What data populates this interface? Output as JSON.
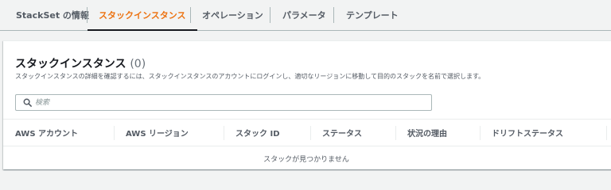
{
  "tabs": [
    {
      "label": "StackSet の情報",
      "active": false
    },
    {
      "label": "スタックインスタンス",
      "active": true
    },
    {
      "label": "オペレーション",
      "active": false
    },
    {
      "label": "パラメータ",
      "active": false
    },
    {
      "label": "テンプレート",
      "active": false
    }
  ],
  "panel": {
    "title": "スタックインスタンス",
    "count": "(0)",
    "description": "スタックインスタンスの詳細を確認するには、スタックインスタンスのアカウントにログインし、適切なリージョンに移動して目的のスタックを名前で選択します。"
  },
  "search": {
    "placeholder": "検索",
    "value": ""
  },
  "table": {
    "columns": [
      "AWS アカウント",
      "AWS リージョン",
      "スタック ID",
      "ステータス",
      "状況の理由",
      "ドリフトステータス"
    ],
    "empty_message": "スタックが見つかりません"
  },
  "colors": {
    "accent": "#ec7211",
    "text": "#16191f",
    "muted": "#545b64"
  },
  "icons": {
    "search": "search-icon"
  }
}
